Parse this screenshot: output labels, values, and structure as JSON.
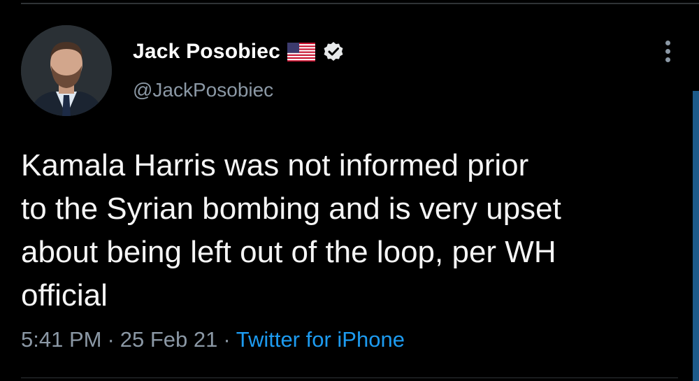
{
  "tweet": {
    "author": {
      "display_name": "Jack Posobiec",
      "handle": "@JackPosobiec",
      "flag_icon": "us-flag-icon",
      "verified_icon": "verified-badge-icon",
      "avatar": "profile-photo"
    },
    "text": "Kamala Harris was not informed prior\nto the Syrian bombing and is very upset\nabout being left out of the loop, per WH\nofficial",
    "time": "5:41 PM",
    "separator": "·",
    "date": "25 Feb 21",
    "source": "Twitter for iPhone",
    "more_icon": "more-vertical-icon"
  },
  "colors": {
    "background": "#000000",
    "text": "#e7e9ea",
    "secondary": "#8b98a5",
    "link": "#1d9bf0"
  }
}
